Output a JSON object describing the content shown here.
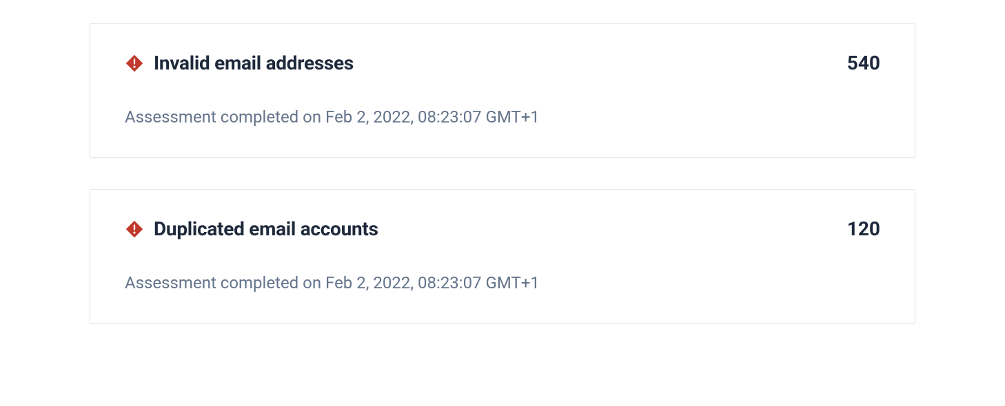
{
  "cards": [
    {
      "title": "Invalid email addresses",
      "count": "540",
      "subtitle": "Assessment completed on Feb 2, 2022, 08:23:07 GMT+1"
    },
    {
      "title": "Duplicated email accounts",
      "count": "120",
      "subtitle": "Assessment completed on Feb 2, 2022, 08:23:07 GMT+1"
    }
  ],
  "colors": {
    "alert": "#c0392b"
  }
}
